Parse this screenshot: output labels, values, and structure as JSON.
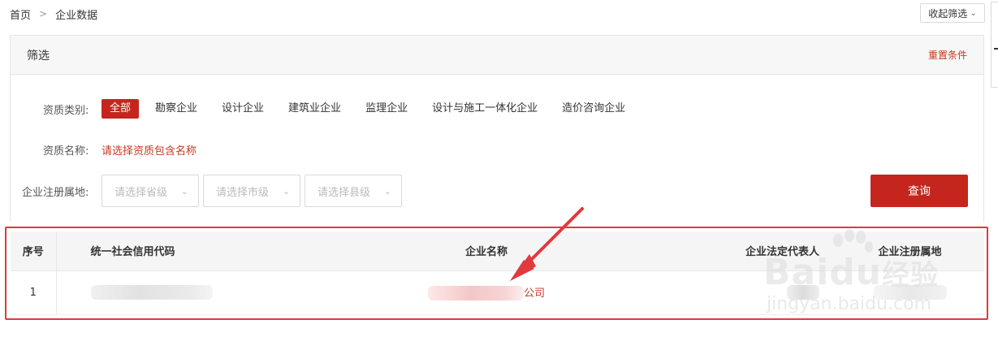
{
  "breadcrumb": {
    "home": "首页",
    "separator": ">",
    "current": "企业数据"
  },
  "collapse_button": {
    "label": "收起筛选",
    "icon": "chevron-down-icon"
  },
  "filter": {
    "title": "筛选",
    "reset_label": "重置条件",
    "type_label": "资质类别:",
    "types": [
      {
        "label": "全部",
        "active": true
      },
      {
        "label": "勘察企业",
        "active": false
      },
      {
        "label": "设计企业",
        "active": false
      },
      {
        "label": "建筑业企业",
        "active": false
      },
      {
        "label": "监理企业",
        "active": false
      },
      {
        "label": "设计与施工一体化企业",
        "active": false
      },
      {
        "label": "造价咨询企业",
        "active": false
      }
    ],
    "name_label": "资质名称:",
    "name_placeholder": "请选择资质包含名称",
    "region_label": "企业注册属地:",
    "province_placeholder": "请选择省级",
    "city_placeholder": "请选择市级",
    "county_placeholder": "请选择县级",
    "query_label": "查询"
  },
  "table": {
    "headers": {
      "index": "序号",
      "credit_code": "统一社会信用代码",
      "company_name": "企业名称",
      "legal_rep": "企业法定代表人",
      "registered_place": "企业注册属地"
    },
    "rows": [
      {
        "index": "1",
        "company_name_suffix": "公司"
      }
    ]
  },
  "watermark": {
    "brand": "Baidu",
    "cn": "经验",
    "url": "jingyan.baidu.com"
  },
  "colors": {
    "accent": "#c4261d",
    "link": "#c23b22",
    "highlight": "#e0393e"
  }
}
